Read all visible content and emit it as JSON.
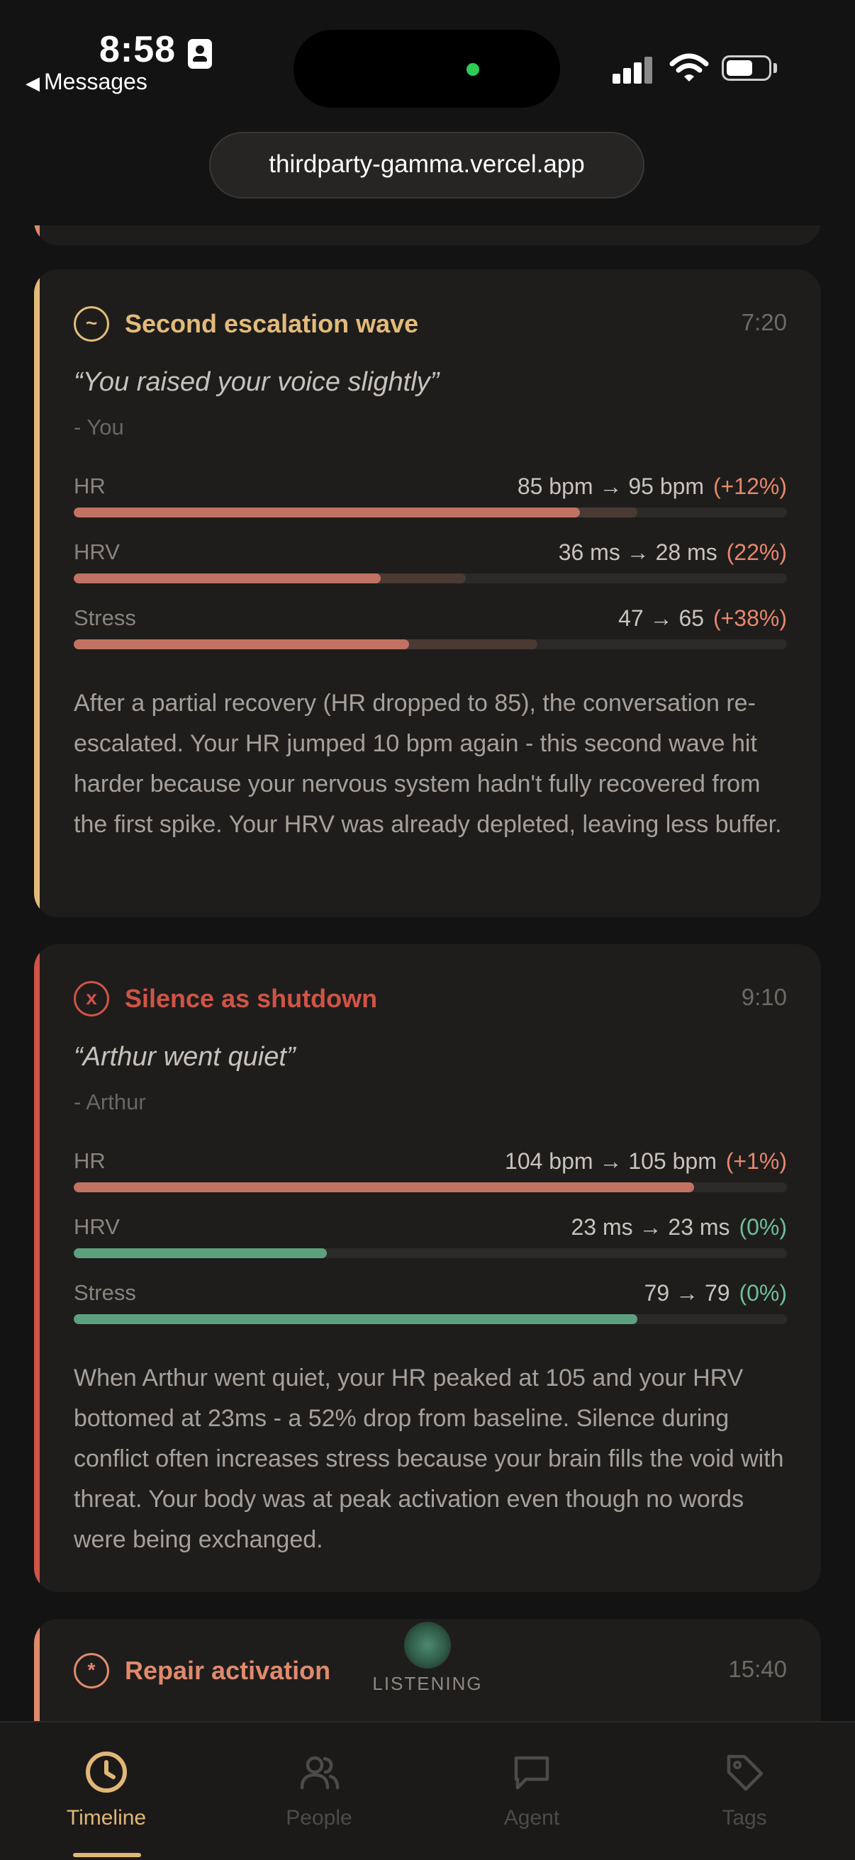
{
  "status_bar": {
    "time": "8:58",
    "back_label": "Messages"
  },
  "browser": {
    "url": "thirdparty-gamma.vercel.app"
  },
  "cards": {
    "wave": {
      "icon_glyph": "~",
      "title": "Second escalation wave",
      "time": "7:20",
      "quote": "“You raised your voice slightly”",
      "attribution": "- You",
      "accent_color": "#e2bb7a",
      "metrics": [
        {
          "label": "HR",
          "value": "85 bpm → 95 bpm",
          "change": "(+12%)",
          "level": 0.71,
          "previous_level": 0.79,
          "bar_color": "#c27262",
          "change_color": "#e7876b"
        },
        {
          "label": "HRV",
          "value": "36 ms → 28 ms",
          "change": "(22%)",
          "level": 0.43,
          "previous_level": 0.55,
          "bar_color": "#c27262",
          "change_color": "#e7876b"
        },
        {
          "label": "Stress",
          "value": "47 → 65",
          "change": "(+38%)",
          "level": 0.47,
          "previous_level": 0.65,
          "bar_color": "#c27262",
          "change_color": "#e7876b"
        }
      ],
      "description": "After a partial recovery (HR dropped to 85), the conversation re-escalated. Your HR jumped 10 bpm again - this second wave hit harder because your nervous system hadn't fully recovered from the first spike. Your HRV was already depleted, leaving less buffer."
    },
    "silence": {
      "icon_glyph": "x",
      "title": "Silence as shutdown",
      "time": "9:10",
      "quote": "“Arthur went quiet”",
      "attribution": "- Arthur",
      "accent_color": "#cf5446",
      "metrics": [
        {
          "label": "HR",
          "value": "104 bpm → 105 bpm",
          "change": "(+1%)",
          "level": 0.87,
          "previous_level": 0.87,
          "bar_color": "#c27262",
          "change_color": "#e7876b"
        },
        {
          "label": "HRV",
          "value": "23 ms → 23 ms",
          "change": "(0%)",
          "level": 0.355,
          "previous_level": 0.355,
          "bar_color": "#5da07e",
          "change_color": "#6fbf97"
        },
        {
          "label": "Stress",
          "value": "79 → 79",
          "change": "(0%)",
          "level": 0.79,
          "previous_level": 0.79,
          "bar_color": "#5da07e",
          "change_color": "#6fbf97"
        }
      ],
      "description": "When Arthur went quiet, your HR peaked at 105 and your HRV bottomed at 23ms - a 52% drop from baseline. Silence during conflict often increases stress because your brain fills the void with threat. Your body was at peak activation even though no words were being exchanged."
    },
    "repair": {
      "icon_glyph": "*",
      "title": "Repair activation",
      "time": "15:40",
      "accent_color": "#e08a6c"
    }
  },
  "listening": {
    "label": "LISTENING"
  },
  "tabbar": {
    "tabs": [
      {
        "label": "Timeline",
        "icon": "clock-icon",
        "active": true
      },
      {
        "label": "People",
        "icon": "people-icon",
        "active": false
      },
      {
        "label": "Agent",
        "icon": "chat-bubble-icon",
        "active": false
      },
      {
        "label": "Tags",
        "icon": "tag-icon",
        "active": false
      }
    ],
    "active_color": "#e0b777",
    "inactive_color": "#4e4a47"
  }
}
